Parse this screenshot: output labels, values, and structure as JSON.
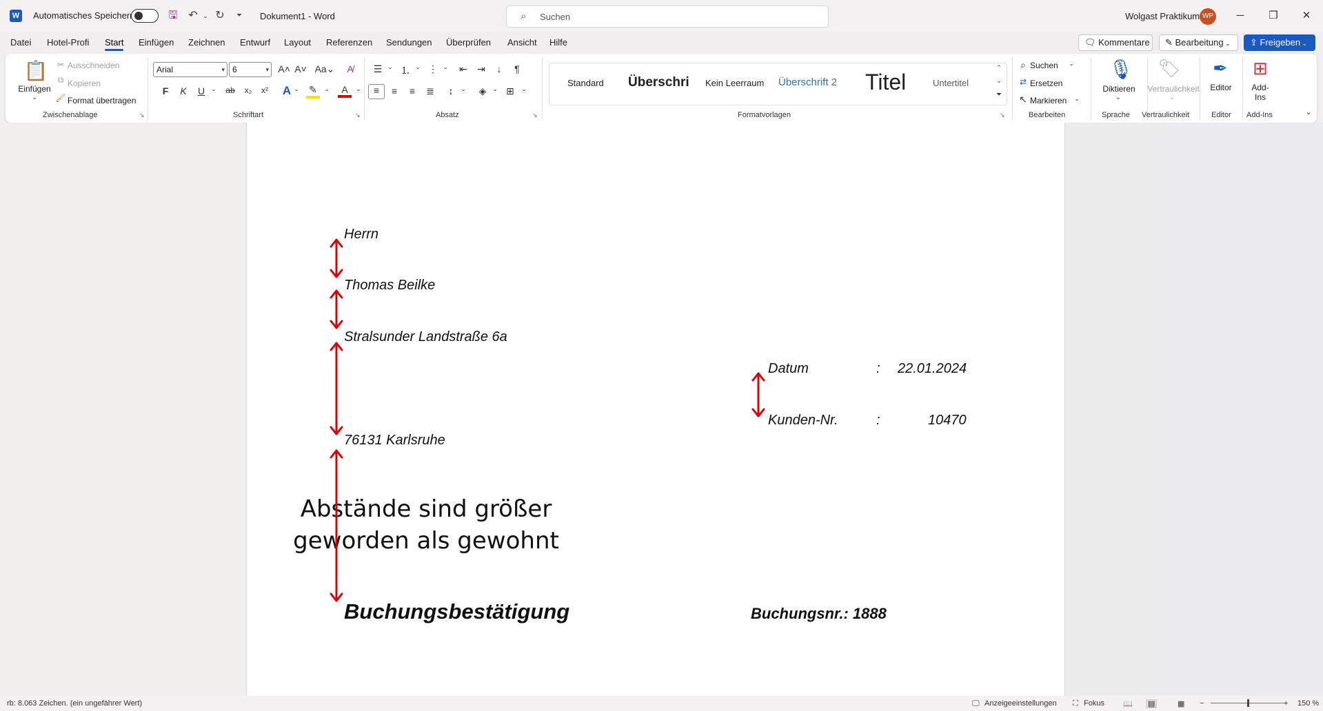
{
  "titlebar": {
    "autosave_label": "Automatisches Speichern",
    "doc_title": "Dokument1  -  Word",
    "search_placeholder": "Suchen",
    "user_name": "Wolgast Praktikum",
    "user_initials": "WP"
  },
  "menu": {
    "tabs": [
      "Datei",
      "Hotel-Profi",
      "Start",
      "Einfügen",
      "Zeichnen",
      "Entwurf",
      "Layout",
      "Referenzen",
      "Sendungen",
      "Überprüfen",
      "Ansicht",
      "Hilfe"
    ],
    "active_tab": "Start",
    "comments_label": "Kommentare",
    "editing_label": "Bearbeitung",
    "share_label": "Freigeben"
  },
  "ribbon": {
    "clipboard": {
      "paste": "Einfügen",
      "cut": "Ausschneiden",
      "copy": "Kopieren",
      "format_painter": "Format übertragen",
      "group": "Zwischenablage"
    },
    "font": {
      "font_name": "Arial",
      "font_size": "6",
      "bold": "F",
      "italic": "K",
      "underline": "U",
      "strike": "ab",
      "sub": "x₂",
      "sup": "x²",
      "group": "Schriftart"
    },
    "paragraph": {
      "group": "Absatz"
    },
    "styles": {
      "items": [
        "Standard",
        "Überschri",
        "Kein Leerraum",
        "Überschrift 2",
        "Titel",
        "Untertitel"
      ],
      "group": "Formatvorlagen"
    },
    "editing": {
      "find": "Suchen",
      "replace": "Ersetzen",
      "select": "Markieren",
      "group": "Bearbeiten"
    },
    "voice": {
      "dictate": "Diktieren",
      "group": "Sprache"
    },
    "sensitivity": {
      "label": "Vertraulichkeit",
      "group": "Vertraulichkeit"
    },
    "editor": {
      "label": "Editor",
      "group": "Editor"
    },
    "addins": {
      "label": "Add-Ins",
      "group": "Add-Ins"
    }
  },
  "document": {
    "salutation": "Herrn",
    "name": "Thomas Beilke",
    "street": "Stralsunder Landstraße 6a",
    "city": "76131 Karlsruhe",
    "date_label": "Datum",
    "date_colon": ":",
    "date_value": "22.01.2024",
    "customer_label": "Kunden-Nr.",
    "customer_colon": ":",
    "customer_value": "10470",
    "annotation_line1": "Abstände sind größer",
    "annotation_line2": "geworden als gewohnt",
    "heading": "Buchungsbestätigung",
    "booking_no": "Buchungsnr.: 1888"
  },
  "statusbar": {
    "word_count": "rb: 8.063 Zeichen. (ein ungefährer Wert)",
    "display_settings": "Anzeigeeinstellungen",
    "focus": "Fokus",
    "zoom_minus": "−",
    "zoom_plus": "+",
    "zoom": "150 %"
  },
  "colors": {
    "accent": "#185abd",
    "arrow": "#e00000",
    "avatar": "#c8501e"
  }
}
